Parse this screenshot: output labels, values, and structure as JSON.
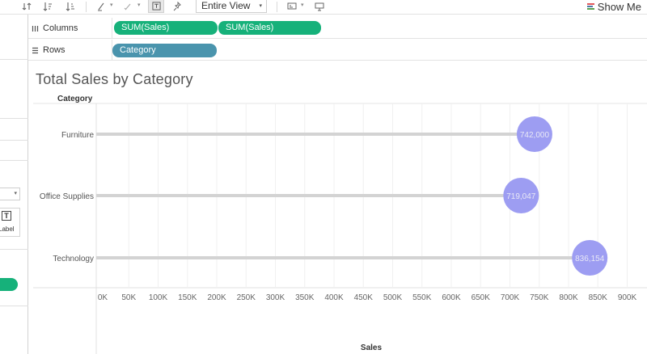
{
  "toolbar": {
    "view_select": "Entire View",
    "show_me": "Show Me"
  },
  "shelves": {
    "columns_label": "Columns",
    "rows_label": "Rows",
    "columns_pills": [
      "SUM(Sales)",
      "SUM(Sales)"
    ],
    "rows_pills": [
      "Category"
    ]
  },
  "left_pane": {
    "label_card": "Label"
  },
  "chart": {
    "title": "Total Sales by Category",
    "row_header": "Category",
    "axis_title": "Sales"
  },
  "colors": {
    "pill_green": "#16b17a",
    "pill_blue": "#4a94ad",
    "bar_gray": "#d3d3d3",
    "circle": "#9d9df2"
  },
  "chart_data": {
    "type": "scatter",
    "subtype": "lollipop",
    "title": "Total Sales by Category",
    "xlabel": "Sales",
    "ylabel": "Category",
    "categories": [
      "Furniture",
      "Office Supplies",
      "Technology"
    ],
    "values": [
      742000,
      719047,
      836154
    ],
    "data_labels": [
      "742,000",
      "719,047",
      "836,154"
    ],
    "xlim": [
      0,
      900000
    ],
    "xticks": [
      0,
      50000,
      100000,
      150000,
      200000,
      250000,
      300000,
      350000,
      400000,
      450000,
      500000,
      550000,
      600000,
      650000,
      700000,
      750000,
      800000,
      850000,
      900000
    ],
    "xtick_labels": [
      "0K",
      "50K",
      "100K",
      "150K",
      "200K",
      "250K",
      "300K",
      "350K",
      "400K",
      "450K",
      "500K",
      "550K",
      "600K",
      "650K",
      "700K",
      "750K",
      "800K",
      "850K",
      "900K"
    ],
    "grid": true
  }
}
